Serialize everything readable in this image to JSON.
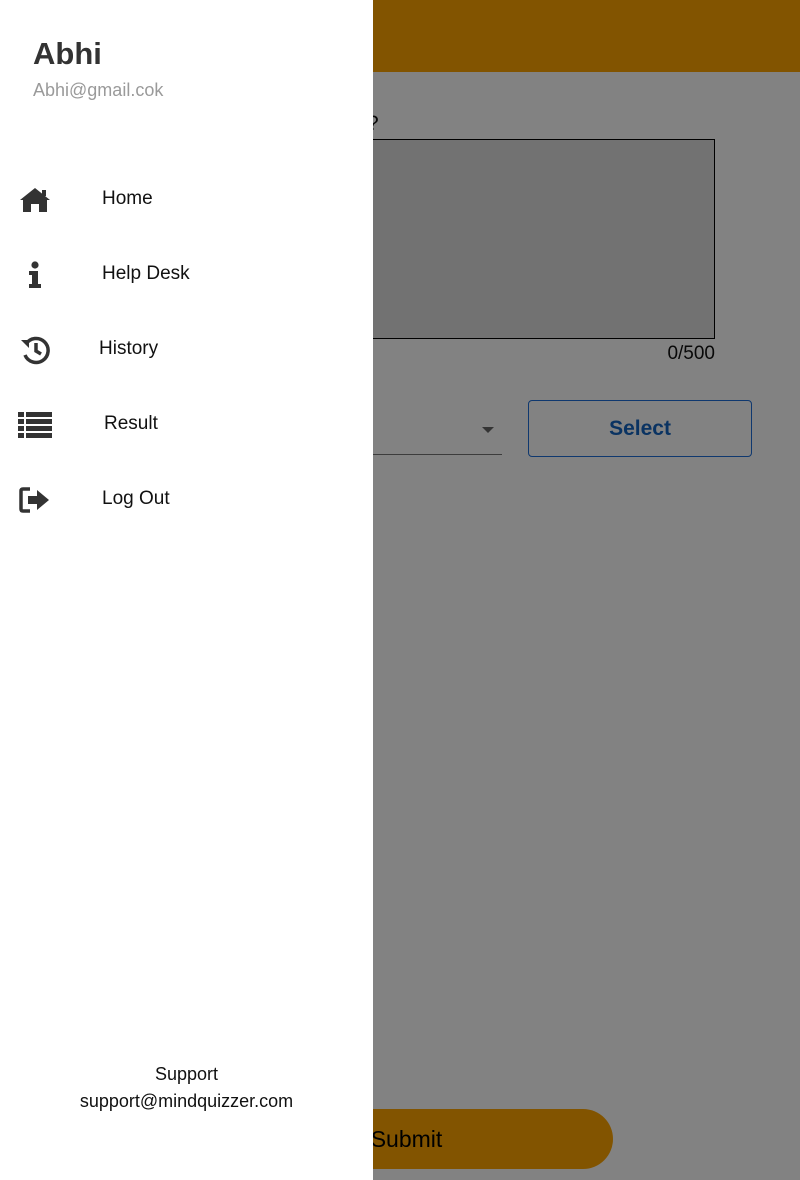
{
  "page": {
    "question_fragment": "?",
    "counter": "0/500",
    "select_label": "Select",
    "submit_label": "Submit"
  },
  "drawer": {
    "user_name": "Abhi",
    "user_email": "Abhi@gmail.cok",
    "items": [
      {
        "label": "Home",
        "icon": "home-icon"
      },
      {
        "label": "Help Desk",
        "icon": "info-icon"
      },
      {
        "label": "History",
        "icon": "history-icon"
      },
      {
        "label": "Result",
        "icon": "list-icon"
      },
      {
        "label": "Log Out",
        "icon": "logout-icon"
      }
    ],
    "support_title": "Support",
    "support_email": "support@mindquizzer.com"
  },
  "colors": {
    "appbar": "#ffa600",
    "select_accent": "#1565c0",
    "scrim": "rgba(0,0,0,0.49)"
  }
}
